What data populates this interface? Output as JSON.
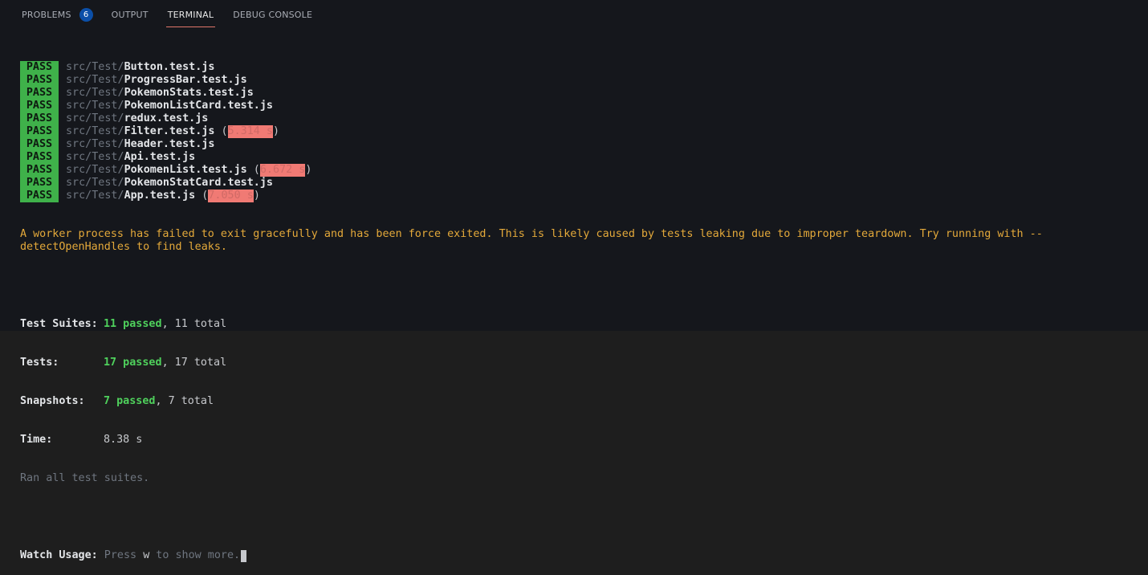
{
  "tabs": [
    {
      "label": "PROBLEMS",
      "badge": "6"
    },
    {
      "label": "OUTPUT"
    },
    {
      "label": "TERMINAL"
    },
    {
      "label": "DEBUG CONSOLE"
    }
  ],
  "active_tab": "TERMINAL",
  "terminal": {
    "pass_label": "PASS",
    "dir": "src/Test/",
    "results": [
      {
        "file": "Button.test.js"
      },
      {
        "file": "ProgressBar.test.js"
      },
      {
        "file": "PokemonStats.test.js"
      },
      {
        "file": "PokemonListCard.test.js"
      },
      {
        "file": "redux.test.js"
      },
      {
        "file": "Filter.test.js",
        "time": "5.314 s"
      },
      {
        "file": "Header.test.js"
      },
      {
        "file": "Api.test.js"
      },
      {
        "file": "PokomenList.test.js",
        "time": "6.672 s"
      },
      {
        "file": "PokemonStatCard.test.js"
      },
      {
        "file": "App.test.js",
        "time": "7.050 s"
      }
    ],
    "warning": "A worker process has failed to exit gracefully and has been force exited. This is likely caused by tests leaking due to improper teardown. Try running with --detectOpenHandles to find leaks.",
    "summary": {
      "suites_label": "Test Suites:",
      "suites_passed": "11 passed",
      "suites_total": ", 11 total",
      "tests_label": "Tests:",
      "tests_passed": "17 passed",
      "tests_total": ", 17 total",
      "snapshots_label": "Snapshots:",
      "snapshots_passed": "7 passed",
      "snapshots_total": ", 7 total",
      "time_label": "Time:",
      "time_value": "8.38 s",
      "ran": "Ran all test suites."
    },
    "watch": {
      "label": "Watch Usage:",
      "press": " Press ",
      "key": "w",
      "rest": " to show more."
    }
  },
  "colors": {
    "pass_bg": "#3fb14a",
    "warning": "#e4a93a",
    "passed": "#4fd15c",
    "slow_bg": "#f07a74"
  }
}
